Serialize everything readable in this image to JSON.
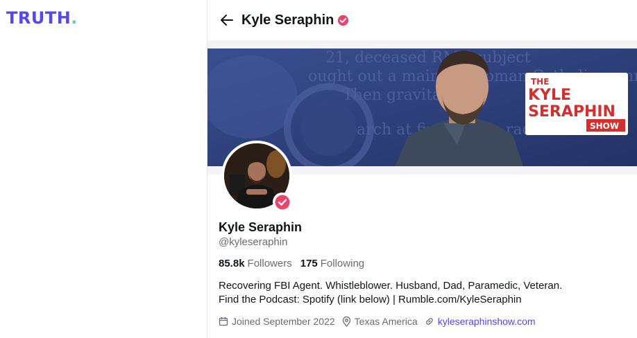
{
  "brand": {
    "logo_text": "TRUTH",
    "logo_dot": ".",
    "accent_color": "#5448ee",
    "dot_color": "#4fd1c5"
  },
  "header": {
    "back_icon": "arrow-left-icon",
    "title": "Kyle Seraphin",
    "verified_icon": "verified-badge-icon"
  },
  "banner": {
    "show_title_line1": "THE",
    "show_title_line2": "KYLE",
    "show_title_line3": "SERAPHIN",
    "show_title_line4": "SHOW",
    "background_text_1": "21, deceased RMV subject",
    "background_text_2": "ought out a mainline Roman Catholic commun",
    "background_text_3": "Then gravitat",
    "background_text_4": "arch at first",
    "background_text_5": "e radicaliz"
  },
  "profile": {
    "name": "Kyle Seraphin",
    "handle": "@kyleseraphin",
    "followers_count": "85.8k",
    "followers_label": "Followers",
    "following_count": "175",
    "following_label": "Following",
    "bio_line1": "Recovering FBI Agent. Whistleblower. Husband, Dad, Paramedic, Veteran.",
    "bio_line2": "Find the Podcast: Spotify (link below) | Rumble.com/KyleSeraphin",
    "joined": "Joined September 2022",
    "location": "Texas America",
    "website": "kyleseraphinshow.com",
    "verified_color": "#e8456b"
  }
}
